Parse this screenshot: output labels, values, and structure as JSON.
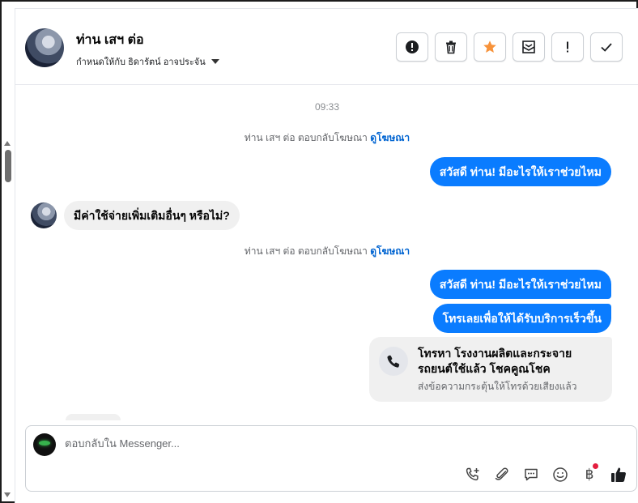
{
  "header": {
    "contact_name": "ท่าน เสฯ ต่อ",
    "assign_label": "กำหนดให้กับ ธิดารัตน์ อาจประจัน",
    "toolbar": [
      {
        "name": "spam-button",
        "icon": "exclamation-circle-icon"
      },
      {
        "name": "delete-button",
        "icon": "trash-icon"
      },
      {
        "name": "star-button",
        "icon": "star-icon",
        "color": "#f7923a"
      },
      {
        "name": "move-to-inbox-button",
        "icon": "mail-envelope-icon"
      },
      {
        "name": "follow-up-button",
        "icon": "exclamation-icon"
      },
      {
        "name": "mark-done-button",
        "icon": "check-icon"
      }
    ]
  },
  "conversation": {
    "time": "09:33",
    "system_1": {
      "text": "ท่าน เสฯ ต่อ ตอบกลับโฆษณา ",
      "link": "ดูโฆษณา"
    },
    "msg_out_1": "สวัสดี ท่าน! มีอะไรให้เราช่วยไหม",
    "msg_in_1": "มีค่าใช้จ่ายเพิ่มเติมอื่นๆ หรือไม่?",
    "system_2": {
      "text": "ท่าน เสฯ ต่อ ตอบกลับโฆษณา ",
      "link": "ดูโฆษณา"
    },
    "msg_out_2": "สวัสดี ท่าน! มีอะไรให้เราช่วยไหม",
    "msg_out_3": "โทรเลยเพื่อให้ได้รับบริการเร็วขึ้น",
    "call_card": {
      "title": "โทรหา โรงงานผลิตและกระจายรถยนต์ใช้แล้ว โชคคูณโชค",
      "subtitle": "ส่งข้อความกระตุ้นให้โทรด้วยเสียงแล้ว"
    }
  },
  "composer": {
    "placeholder": "ตอบกลับใน Messenger...",
    "currency_symbol": "฿",
    "accent_color": "#0a7cff"
  }
}
